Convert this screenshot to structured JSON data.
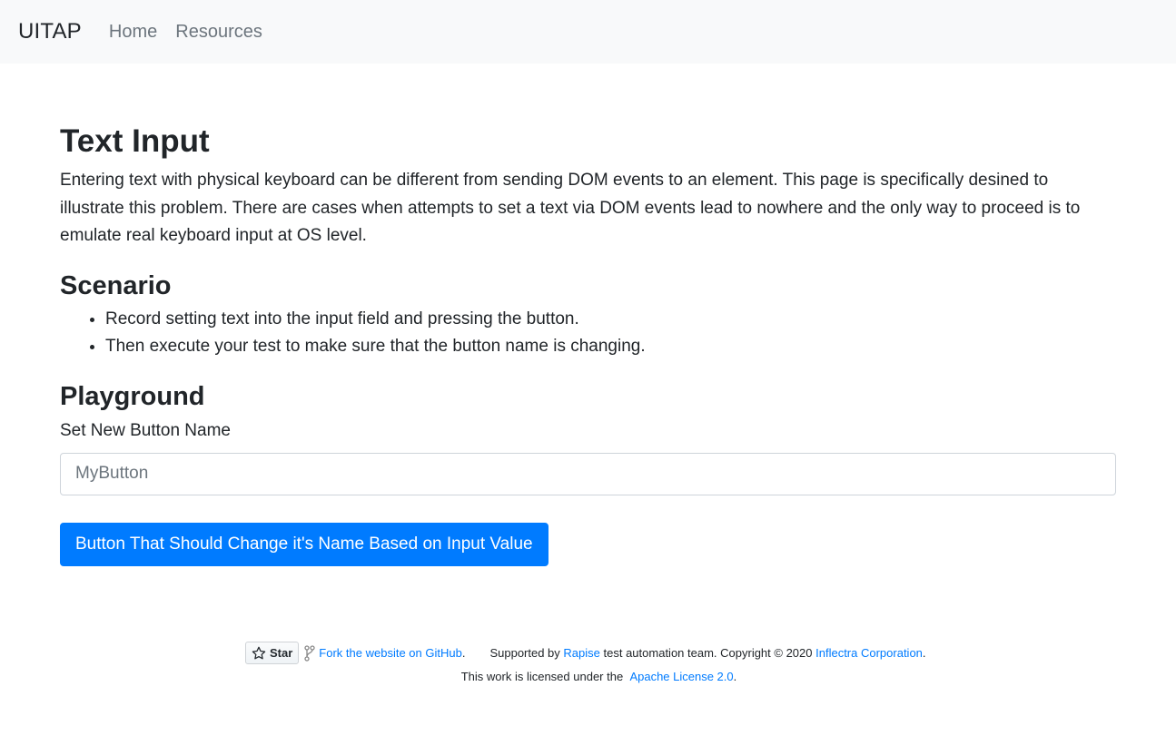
{
  "navbar": {
    "brand": "UITAP",
    "links": [
      "Home",
      "Resources"
    ]
  },
  "main": {
    "title": "Text Input",
    "intro": "Entering text with physical keyboard can be different from sending DOM events to an element. This page is specifically desined to illustrate this problem. There are cases when attempts to set a text via DOM events lead to nowhere and the only way to proceed is to emulate real keyboard input at OS level.",
    "scenario_heading": "Scenario",
    "scenario_items": [
      "Record setting text into the input field and pressing the button.",
      "Then execute your test to make sure that the button name is changing."
    ],
    "playground_heading": "Playground",
    "input_label": "Set New Button Name",
    "input_placeholder": "MyButton",
    "input_value": "",
    "button_label": "Button That Should Change it's Name Based on Input Value"
  },
  "footer": {
    "star_label": "Star",
    "fork_link": "Fork the website on GitHub",
    "fork_suffix": ".",
    "supported_prefix": "Supported by ",
    "rapise_link": "Rapise",
    "supported_middle": " test automation team. Copyright © 2020 ",
    "inflectra_link": "Inflectra Corporation",
    "supported_suffix": ".",
    "license_prefix": "This work is licensed under the ",
    "license_link": "Apache License 2.0",
    "license_suffix": "."
  },
  "colors": {
    "primary": "#007bff",
    "navbar_bg": "#f8f9fa",
    "muted_text": "#6c757d"
  },
  "icons": [
    "star-icon",
    "fork-icon"
  ]
}
